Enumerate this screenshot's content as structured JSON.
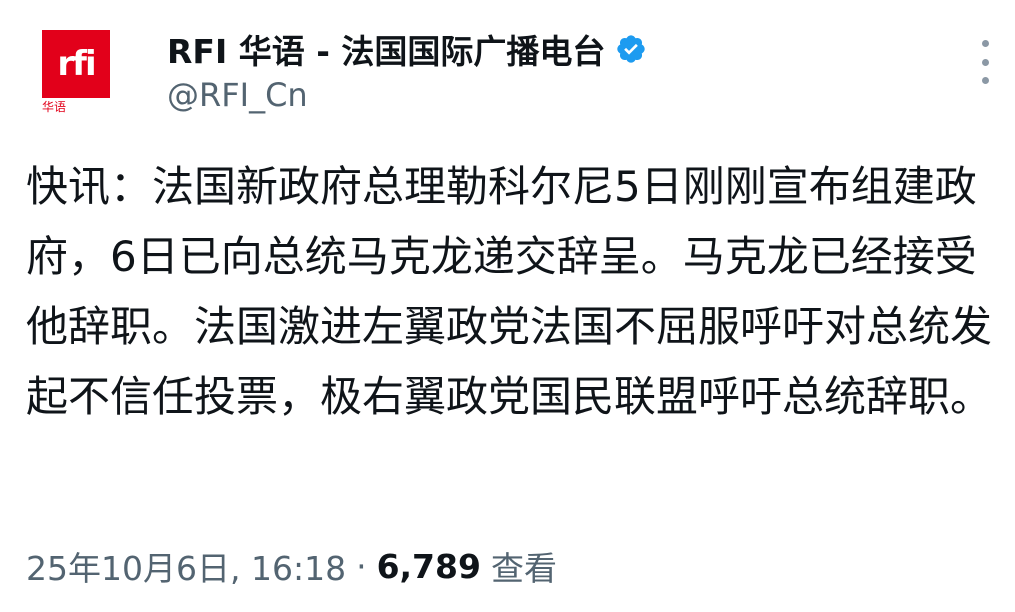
{
  "account": {
    "avatar_logo_text": "rfi",
    "avatar_sub_text": "华语",
    "display_name": "RFI 华语 - 法国国际广播电台",
    "handle": "@RFI_Cn",
    "verified": true,
    "verified_color": "#1d9bf0"
  },
  "tweet": {
    "text": "快讯：法国新政府总理勒科尔尼5日刚刚宣布组建政府，6日已向总统马克龙递交辞呈。马克龙已经接受他辞职。法国激进左翼政党法国不屈服呼吁对总统发起不信任投票，极右翼政党国民联盟呼吁总统辞职。"
  },
  "meta": {
    "timestamp": "25年10月6日, 16:18",
    "separator": "·",
    "views_count": "6,789",
    "views_label": "查看"
  },
  "icons": {
    "more": "more-vertical-icon",
    "verified": "verified-badge-icon"
  },
  "colors": {
    "brand_red": "#e2001a",
    "text_primary": "#0f1419",
    "text_secondary": "#536471"
  }
}
